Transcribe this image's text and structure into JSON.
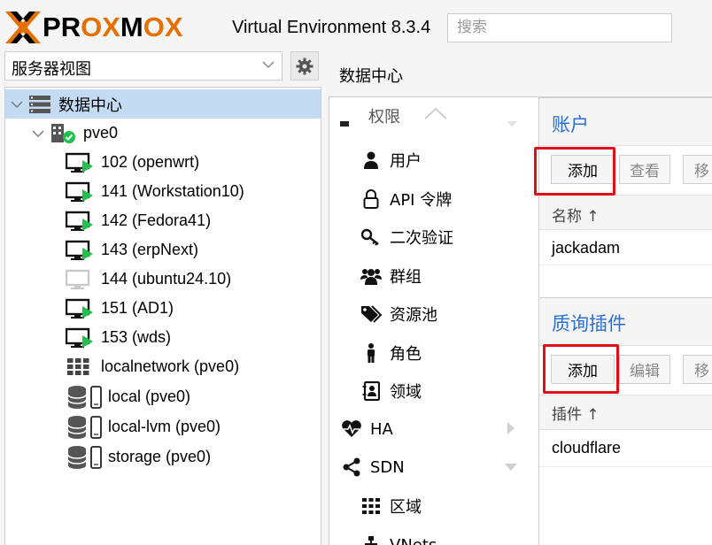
{
  "header": {
    "logo_text": "PROXMOX",
    "product": "Virtual Environment 8.3.4",
    "search_placeholder": "搜索"
  },
  "view_selector": {
    "value": "服务器视图"
  },
  "tree": {
    "datacenter": "数据中心",
    "node": "pve0",
    "items": [
      {
        "label": "102 (openwrt)",
        "icon": "vm-running-icon"
      },
      {
        "label": "141 (Workstation10)",
        "icon": "vm-running-icon"
      },
      {
        "label": "142 (Fedora41)",
        "icon": "vm-running-icon"
      },
      {
        "label": "143 (erpNext)",
        "icon": "vm-running-icon"
      },
      {
        "label": "144 (ubuntu24.10)",
        "icon": "vm-stopped-icon"
      },
      {
        "label": "151 (AD1)",
        "icon": "vm-running-icon"
      },
      {
        "label": "153 (wds)",
        "icon": "vm-running-icon"
      },
      {
        "label": "localnetwork (pve0)",
        "icon": "network-grid-icon"
      },
      {
        "label": "local (pve0)",
        "icon": "storage-icon"
      },
      {
        "label": "local-lvm (pve0)",
        "icon": "storage-icon"
      },
      {
        "label": "storage (pve0)",
        "icon": "storage-icon"
      }
    ]
  },
  "content_header": {
    "title": "数据中心"
  },
  "menu": {
    "group_permissions": "权限",
    "items": [
      {
        "label": "用户",
        "icon": "user-icon"
      },
      {
        "label": "API 令牌",
        "icon": "lock-icon"
      },
      {
        "label": "二次验证",
        "icon": "key-icon"
      },
      {
        "label": "群组",
        "icon": "group-icon"
      },
      {
        "label": "资源池",
        "icon": "tags-icon"
      },
      {
        "label": "角色",
        "icon": "role-icon"
      },
      {
        "label": "领域",
        "icon": "address-book-icon"
      }
    ],
    "ha": "HA",
    "sdn": "SDN",
    "zones": "区域",
    "vnets": "VNets"
  },
  "accounts": {
    "title": "账户",
    "add": "添加",
    "view": "查看",
    "move": "移",
    "column": "名称 ↑",
    "rows": [
      "jackadam"
    ]
  },
  "acme": {
    "title": "质询插件",
    "add": "添加",
    "edit": "编辑",
    "move": "移",
    "column": "插件 ↑",
    "rows": [
      "cloudflare"
    ]
  },
  "colors": {
    "accent": "#e57000",
    "title_blue": "#2a6fd2",
    "selected_row": "#c4dcf3",
    "highlight_box": "#e0101a",
    "running_green": "#21bf4b"
  }
}
